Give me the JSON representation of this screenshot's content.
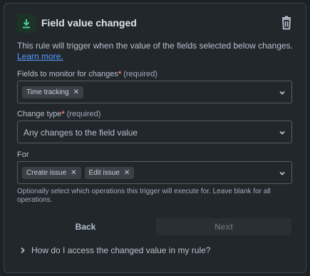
{
  "header": {
    "title": "Field value changed",
    "icon": "field-changed-icon",
    "delete_icon": "trash-icon",
    "accent": "#4bce97"
  },
  "description": {
    "text": "This rule will trigger when the value of the fields selected below changes.",
    "link": "Learn more."
  },
  "fields_to_monitor": {
    "label": "Fields to monitor for changes",
    "required_mark": "*",
    "required_text": "(required)",
    "chips": [
      "Time tracking"
    ]
  },
  "change_type": {
    "label": "Change type",
    "required_mark": "*",
    "required_text": "(required)",
    "value": "Any changes to the field value"
  },
  "for_field": {
    "label": "For",
    "chips": [
      "Create issue",
      "Edit issue"
    ],
    "help": "Optionally select which operations this trigger will execute for. Leave blank for all operations."
  },
  "actions": {
    "back": "Back",
    "next": "Next"
  },
  "faq": {
    "question": "How do I access the changed value in my rule?"
  },
  "colors": {
    "background": "#22272b",
    "link": "#579dff",
    "required": "#f87168"
  }
}
